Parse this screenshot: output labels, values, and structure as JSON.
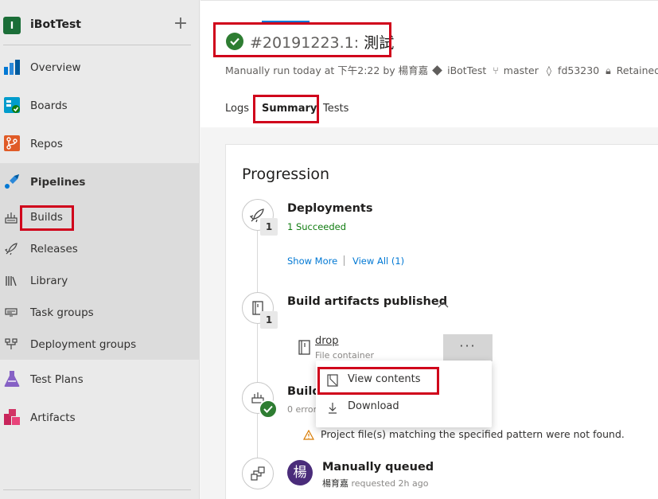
{
  "sidebar": {
    "org_initial": "I",
    "org_name": "iBotTest",
    "add_label": "+",
    "nav": [
      {
        "label": "Overview",
        "icon": "overview-icon"
      },
      {
        "label": "Boards",
        "icon": "boards-icon"
      },
      {
        "label": "Repos",
        "icon": "repos-icon"
      },
      {
        "label": "Pipelines",
        "icon": "pipelines-icon"
      },
      {
        "label": "Test Plans",
        "icon": "test-plans-icon"
      },
      {
        "label": "Artifacts",
        "icon": "artifacts-icon"
      }
    ],
    "pipelines_sub": [
      {
        "label": "Builds",
        "icon": "builds-icon"
      },
      {
        "label": "Releases",
        "icon": "rocket-icon"
      },
      {
        "label": "Library",
        "icon": "library-icon"
      },
      {
        "label": "Task groups",
        "icon": "task-groups-icon"
      },
      {
        "label": "Deployment groups",
        "icon": "deployment-groups-icon"
      }
    ]
  },
  "header": {
    "run_number": "#20191223.1:",
    "run_name": "測試",
    "meta": {
      "trigger": "Manually run today at 下午2:22 by 楊育嘉",
      "project": "iBotTest",
      "branch": "master",
      "commit": "fd53230",
      "retained": "Retained"
    },
    "tabs": [
      "Logs",
      "Summary",
      "Tests"
    ],
    "active_tab": "Summary"
  },
  "progression": {
    "title": "Progression",
    "deployments": {
      "title": "Deployments",
      "count": "1",
      "status": "1 Succeeded",
      "show_more": "Show More",
      "view_all": "View All (1)"
    },
    "artifacts": {
      "title": "Build artifacts published",
      "count": "1",
      "item_name": "drop",
      "item_type": "File container",
      "more_label": "···"
    },
    "build": {
      "title_partial": "Build",
      "errors_partial": "0 erron",
      "warning": "Project file(s) matching the specified pattern were not found."
    },
    "queued": {
      "title": "Manually queued",
      "avatar_char": "楊",
      "user": "楊育嘉",
      "requested": "requested 2h ago"
    }
  },
  "context_menu": {
    "items": [
      {
        "label": "View contents",
        "icon": "view-contents-icon"
      },
      {
        "label": "Download",
        "icon": "download-icon"
      }
    ]
  },
  "colors": {
    "accent": "#0078d4",
    "success": "#107c10",
    "annotation": "#d0021b",
    "warning": "#d87a00"
  }
}
